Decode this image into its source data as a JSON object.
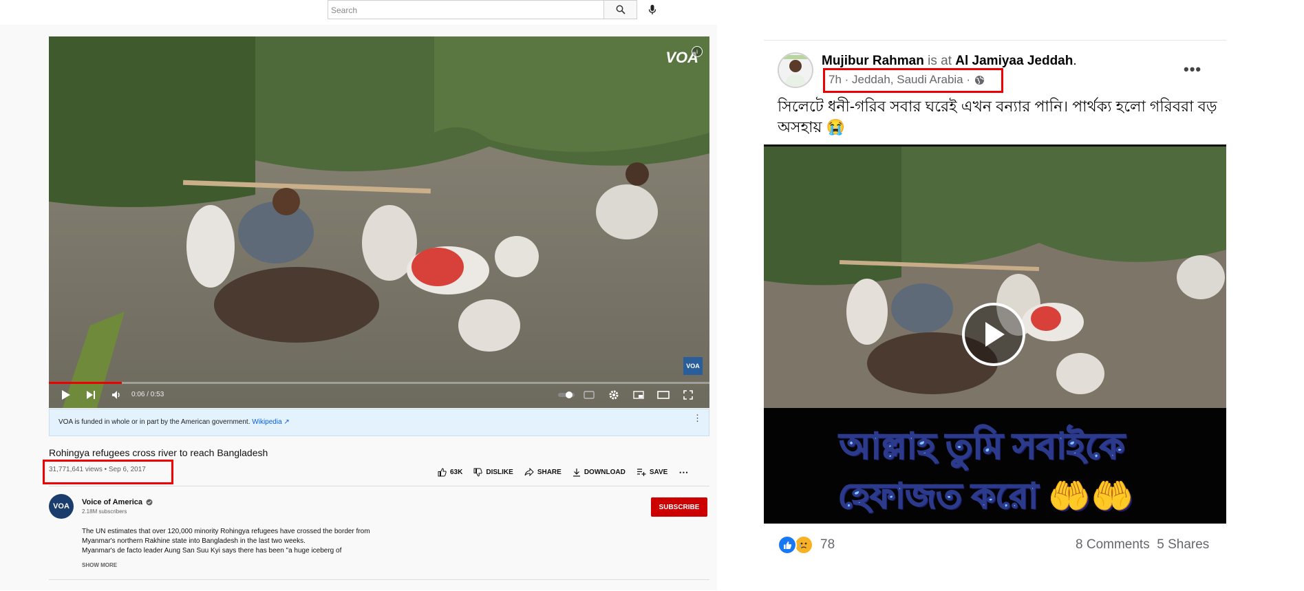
{
  "youtube": {
    "search": {
      "placeholder": "Search"
    },
    "video": {
      "watermark": "VOA",
      "corner_badge": "VOA",
      "time": "0:06 / 0:53",
      "progress_fraction": 0.11
    },
    "info_banner": {
      "text": "VOA is funded in whole or in part by the American government.",
      "link": "Wikipedia"
    },
    "title": "Rohingya refugees cross river to reach Bangladesh",
    "views_date": "31,771,641 views • Sep 6, 2017",
    "actions": {
      "like_count": "63K",
      "dislike": "DISLIKE",
      "share": "SHARE",
      "download": "DOWNLOAD",
      "save": "SAVE"
    },
    "channel": {
      "avatar_text": "VOA",
      "name": "Voice of America",
      "subscribers": "2.18M subscribers",
      "subscribe_label": "SUBSCRIBE"
    },
    "description": [
      "The UN estimates that over 120,000 minority Rohingya refugees have crossed the border from",
      "Myanmar's northern Rakhine state into Bangladesh in the last two weeks.",
      "Myanmar's de facto leader Aung San Suu Kyi says there has been \"a huge iceberg of"
    ],
    "show_more": "SHOW MORE"
  },
  "facebook": {
    "author": "Mujibur Rahman",
    "is_at": "is at",
    "place": "Al Jamiyaa Jeddah",
    "meta": "7h · Jeddah, Saudi Arabia ·",
    "post_text": "সিলেটে ধনী-গরিব সবার ঘরেই এখন বন্যার পানি। পার্থক্য হলো গরিবরা বড় অসহায় 😭",
    "caption_line1": "আল্লাহ তুমি সবাইকে",
    "caption_line2": "হেফাজত করো 🤲🤲",
    "reaction_count": "78",
    "comments": "8 Comments",
    "shares": "5 Shares"
  },
  "colors": {
    "youtube_red": "#cc0000",
    "highlight_box": "#ee0000",
    "facebook_blue": "#1877f2",
    "link_blue": "#065fd4"
  }
}
